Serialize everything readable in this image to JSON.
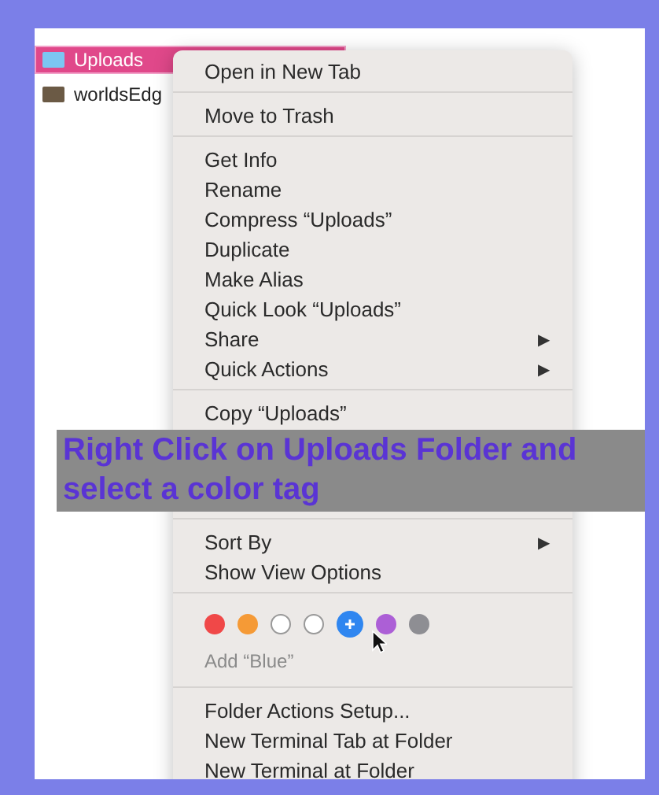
{
  "files": [
    {
      "name": "Uploads",
      "selected": true
    },
    {
      "name": "worldsEdg",
      "selected": false
    }
  ],
  "menu": {
    "sections": [
      {
        "kind": "items",
        "items": [
          {
            "label": "Open in New Tab"
          }
        ]
      },
      {
        "kind": "items",
        "items": [
          {
            "label": "Move to Trash"
          }
        ]
      },
      {
        "kind": "items",
        "items": [
          {
            "label": "Get Info"
          },
          {
            "label": "Rename"
          },
          {
            "label": "Compress “Uploads”"
          },
          {
            "label": "Duplicate"
          },
          {
            "label": "Make Alias"
          },
          {
            "label": "Quick Look “Uploads”"
          },
          {
            "label": "Share",
            "arrow": "▶"
          },
          {
            "label": "Quick Actions",
            "arrow": "▶"
          }
        ]
      },
      {
        "kind": "items",
        "items": [
          {
            "label": "Copy “Uploads”"
          }
        ]
      },
      {
        "kind": "caption",
        "caption": "Right Click on Uploads Folder and select a color tag"
      },
      {
        "kind": "items",
        "items": [
          {
            "label": "Sort By",
            "arrow": "▶"
          },
          {
            "label": "Show View Options"
          }
        ]
      },
      {
        "kind": "tags",
        "tags": [
          {
            "color": "#f04848",
            "selected": false
          },
          {
            "color": "#f59a36",
            "selected": false
          },
          {
            "color": "#ffffff",
            "selected": false
          },
          {
            "color": "#ffffff",
            "selected": false
          },
          {
            "color": "#2f86f0",
            "selected": true
          },
          {
            "color": "#ac5fd6",
            "selected": false
          },
          {
            "color": "#8e8e93",
            "selected": false
          }
        ],
        "tag_hint": "Add “Blue”"
      },
      {
        "kind": "items",
        "items": [
          {
            "label": "Folder Actions Setup..."
          },
          {
            "label": "New Terminal Tab at Folder"
          },
          {
            "label": "New Terminal at Folder"
          }
        ]
      }
    ]
  }
}
